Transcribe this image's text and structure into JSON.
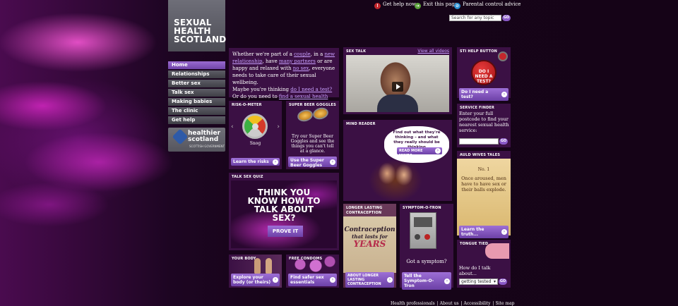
{
  "header": {
    "logo_lines": [
      "SEXUAL",
      "HEALTH",
      "SCOTLAND"
    ],
    "help_label": "Get help now",
    "exit_label": "Exit this page",
    "parental_label": "Parental control advice",
    "search_placeholder": "Search for any topic",
    "go_label": "GO"
  },
  "nav": {
    "items": [
      "Home",
      "Relationships",
      "Better sex",
      "Talk sex",
      "Making babies",
      "The clinic",
      "Get help"
    ]
  },
  "healthier": {
    "line1": "healthier",
    "line2": "scotland",
    "sub": "SCOTTISH GOVERNMENT"
  },
  "intro": {
    "t1": "Whether we're part of a ",
    "l_couple": "couple",
    "t2": ", in a ",
    "l_new": "new relationship",
    "t3": ", have ",
    "l_many": "many partners",
    "t4": " or are happy and relaxed with ",
    "l_nosex": "no sex",
    "t5": ", everyone needs to take care of their sexual wellbeing.",
    "t6": "Maybe you're thinking ",
    "l_test": "do I need a test?",
    "t7": "Or do you need to ",
    "l_service": "find a sexual health service?"
  },
  "sex_talk": {
    "title": "SEX TALK",
    "link": "View all videos"
  },
  "sti": {
    "title": "STI HELP BUTTON",
    "circle_text": "DO I NEED A TEST?",
    "button": "Do I need a test?"
  },
  "risk": {
    "title": "RISK-O-METER",
    "label": "Snog",
    "button": "Learn the risks"
  },
  "beer": {
    "title": "SUPER BEER GOGGLES",
    "text": "Try our Super Beer Goggles and see the things you can't tell at a glance.",
    "button": "Use the Super Beer Goggles"
  },
  "mind": {
    "title": "MIND READER",
    "bubble": "Find out what they're thinking – and what they really should be thinking",
    "button": "READ MORE MINDS"
  },
  "finder": {
    "title": "SERVICE FINDER",
    "text": "Enter your full postcode to find your nearest sexual health service:",
    "go": "GO"
  },
  "quiz": {
    "title": "TALK SEX QUIZ",
    "headline": "THINK YOU KNOW HOW TO TALK ABOUT SEX?",
    "button": "PROVE IT"
  },
  "wives": {
    "title": "AULD WIVES TALES",
    "number": "No. 1",
    "text": "Once aroused, men have to have sex or their balls explode.",
    "button": "Learn the truth..."
  },
  "contraception": {
    "title": "LONGER LASTING CONTRACEPTION",
    "art1": "Contraception",
    "art2": "that lasts for",
    "art3": "YEARS",
    "button": "ABOUT LONGER LASTING CONTRACEPTION"
  },
  "symptom": {
    "title": "SYMPTOM-O-TRON",
    "text": "Got a symptom?",
    "button": "Tell the Symptom-O-Tron"
  },
  "body_panel": {
    "title": "YOUR BODY",
    "button": "Explore your body (or theirs)"
  },
  "condoms": {
    "title": "FREE CONDOMS",
    "button": "Find safer sex essentials"
  },
  "tongue": {
    "title": "TONGUE TIED",
    "text": "How do I talk about...",
    "select": "getting tested",
    "go": "GO"
  },
  "footer": {
    "links": [
      "Health professionals",
      "About us",
      "Accessibility",
      "Site map"
    ]
  },
  "colors": {
    "panel": "#3b1044",
    "accent": "#8a5ac8",
    "link": "#c9a0ff"
  }
}
